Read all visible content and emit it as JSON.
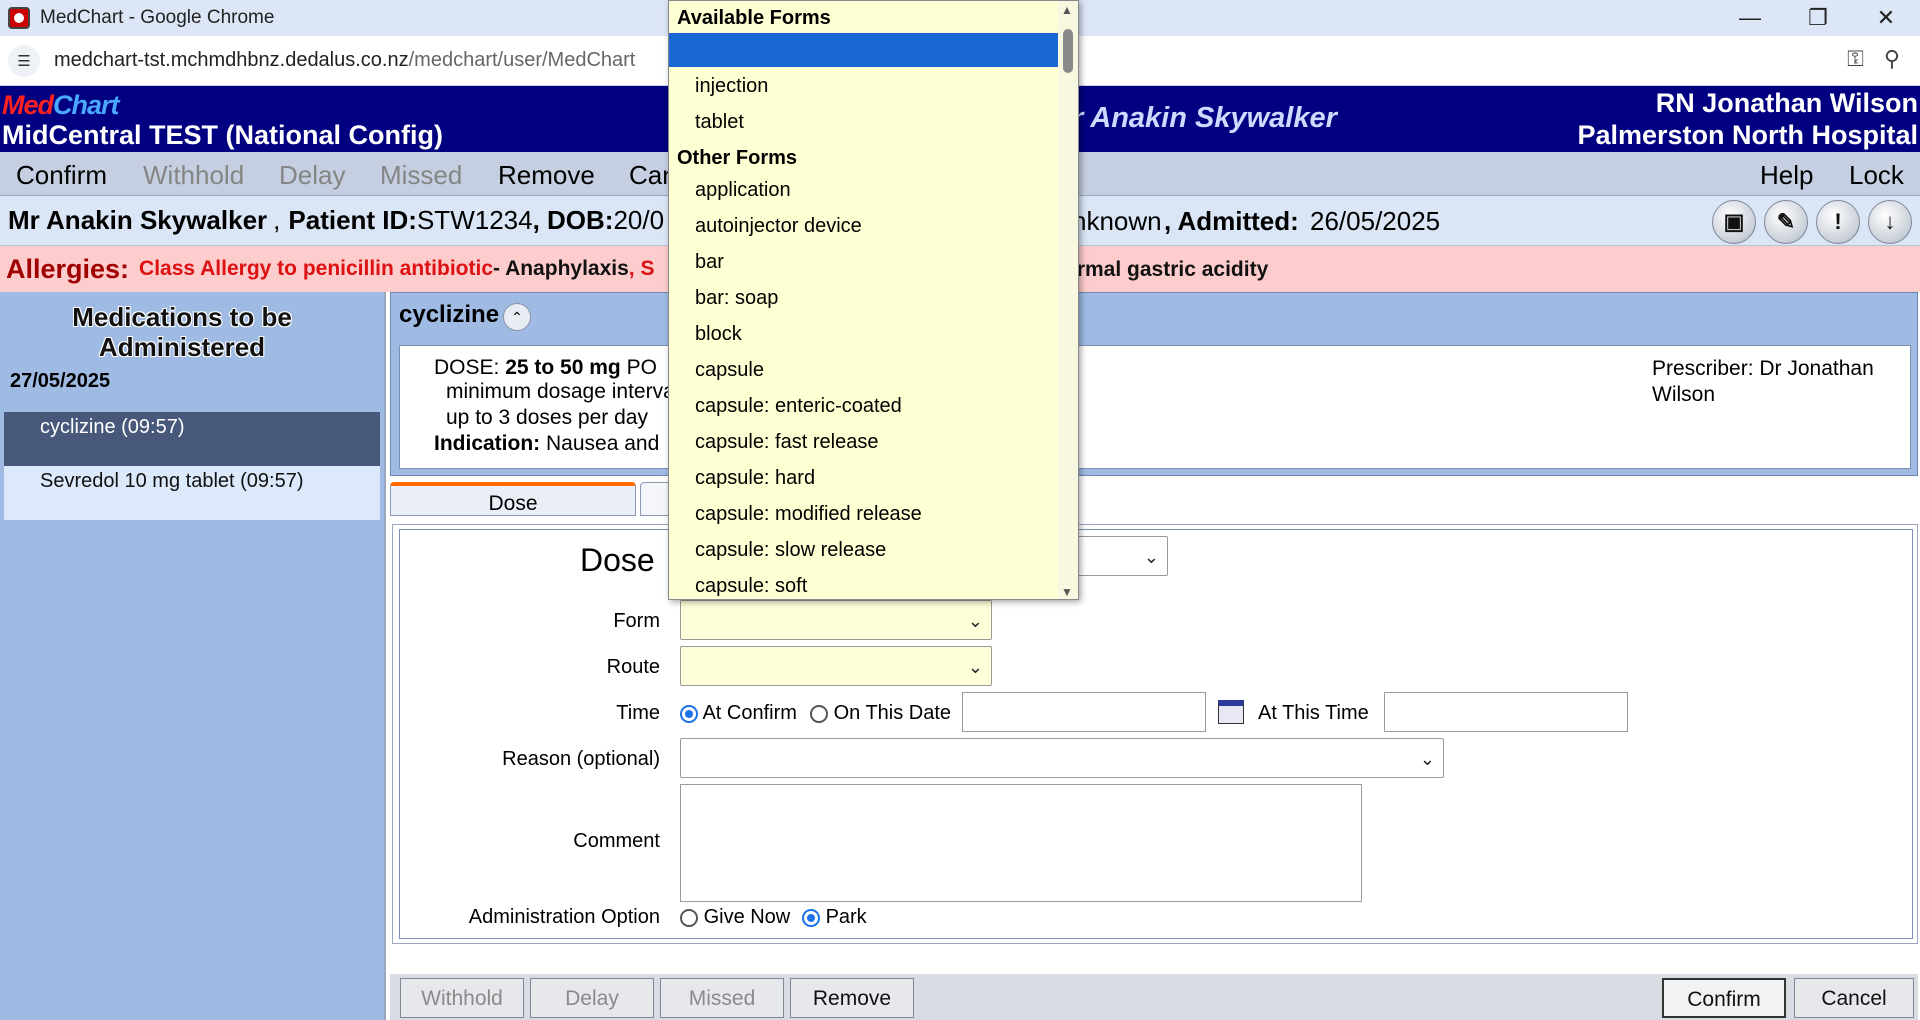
{
  "browser": {
    "title": "MedChart - Google Chrome",
    "url_host": "medchart-tst.mchmdhbnz.dedalus.co.nz",
    "url_path": "/medchart/user/MedChart"
  },
  "header": {
    "logo_med": "Med",
    "logo_chart": "Chart",
    "site_name": "MidCentral TEST (National Config)",
    "patient_name": "r Anakin Skywalker",
    "user": "RN Jonathan Wilson",
    "hospital": "Palmerston North Hospital"
  },
  "menu": {
    "confirm": "Confirm",
    "withhold": "Withhold",
    "delay": "Delay",
    "missed": "Missed",
    "remove": "Remove",
    "cancel_partial": "Can",
    "help": "Help",
    "lock": "Lock"
  },
  "patient": {
    "name": "Mr Anakin Skywalker",
    "sep": ",",
    "id_label": "Patient ID:",
    "id_value": "STW1234",
    "dob_label": ", DOB:",
    "dob_value": "20/0",
    "unknown_tail": "nknown",
    "admitted_label": ", Admitted:",
    "admitted_value": "26/05/2025"
  },
  "allergies": {
    "label": "Allergies:",
    "item1": "Class Allergy to penicillin antibiotic",
    "reaction1": " - Anaphylaxis",
    "comma_s": ", S",
    "tail": "ormal gastric acidity"
  },
  "left": {
    "title": "Medications to be Administered",
    "date": "27/05/2025",
    "items": [
      "cyclizine (09:57)",
      "Sevredol 10 mg tablet (09:57)"
    ]
  },
  "drug": {
    "name": "cyclizine",
    "dose_label": "DOSE: ",
    "dose_value": "25 to 50 mg",
    "dose_route": " PO",
    "line2": "minimum dosage interva",
    "line3": "up to 3 doses per day",
    "indication_label": "Indication:",
    "indication_value": " Nausea and",
    "prescriber": "Prescriber: Dr Jonathan Wilson"
  },
  "tabs": {
    "dose": "Dose"
  },
  "form": {
    "dose_label": "Dose",
    "form_label": "Form",
    "route_label": "Route",
    "time_label": "Time",
    "at_confirm": "At Confirm",
    "on_this_date": "On This Date",
    "at_this_time": "At This Time",
    "reason_label": "Reason (optional)",
    "comment_label": "Comment",
    "admin_option_label": "Administration Option",
    "give_now": "Give Now",
    "park": "Park"
  },
  "buttons": {
    "withhold": "Withhold",
    "delay": "Delay",
    "missed": "Missed",
    "remove": "Remove",
    "confirm": "Confirm",
    "cancel": "Cancel"
  },
  "dropdown": {
    "group1": "Available Forms",
    "group1_items": [
      "",
      "injection",
      "tablet"
    ],
    "group2": "Other Forms",
    "group2_items": [
      "application",
      "autoinjector device",
      "bar",
      "bar: soap",
      "block",
      "capsule",
      "capsule: enteric-coated",
      "capsule: fast release",
      "capsule: hard",
      "capsule: modified release",
      "capsule: slow release",
      "capsule: soft"
    ]
  },
  "colors": {
    "header_bg": "#000080",
    "menu_bg": "#c5cfe1",
    "panel_bg": "#9fbbe4",
    "allergy_bg": "#fdcccc",
    "dropdown_bg": "#ffffd4",
    "highlight": "#1967d2",
    "tab_accent": "#ff6a00"
  }
}
